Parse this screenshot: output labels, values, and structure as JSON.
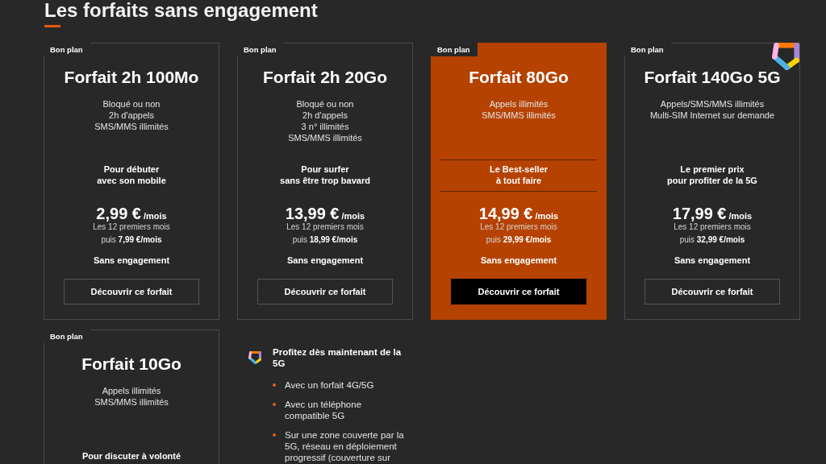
{
  "heading": {
    "title": "Les forfaits sans engagement"
  },
  "plans": [
    {
      "badge": "Bon plan",
      "name": "Forfait 2h 100Mo",
      "features": [
        "Bloqué ou non",
        "2h d'appels",
        "SMS/MMS illimités"
      ],
      "tagline": "Pour débuter\navec son mobile",
      "price": "2,99 €",
      "period": "/mois",
      "price_note": "Les 12 premiers mois",
      "later_price": "puis **7,99 €/mois**",
      "commitment": "Sans engagement",
      "button": "Découvrir ce forfait",
      "featured": false,
      "is_5g": false
    },
    {
      "badge": "Bon plan",
      "name": "Forfait 2h 20Go",
      "features": [
        "Bloqué ou non",
        "2h d'appels",
        "3 n° illimités",
        "SMS/MMS illimités"
      ],
      "tagline": "Pour surfer\nsans être trop bavard",
      "price": "13,99 €",
      "period": "/mois",
      "price_note": "Les 12 premiers mois",
      "later_price": "puis **18,99 €/mois**",
      "commitment": "Sans engagement",
      "button": "Découvrir ce forfait",
      "featured": false,
      "is_5g": false
    },
    {
      "badge": "Bon plan",
      "name": "Forfait 80Go",
      "features": [
        "Appels illimités",
        "SMS/MMS illimités"
      ],
      "tagline": "Le Best-seller\nà tout faire",
      "price": "14,99 €",
      "period": "/mois",
      "price_note": "Les 12 premiers mois",
      "later_price": "puis **29,99 €/mois**",
      "commitment": "Sans engagement",
      "button": "Découvrir ce forfait",
      "featured": true,
      "is_5g": false
    },
    {
      "badge": "Bon plan",
      "name": "Forfait 140Go 5G",
      "features": [
        "Appels/SMS/MMS illimités",
        "Multi-SIM Internet sur demande"
      ],
      "tagline": "Le premier prix\npour profiter de la 5G",
      "price": "17,99 €",
      "period": "/mois",
      "price_note": "Les 12 premiers mois",
      "later_price": "puis **32,99 €/mois**",
      "commitment": "Sans engagement",
      "button": "Découvrir ce forfait",
      "featured": false,
      "is_5g": true
    },
    {
      "badge": "Bon plan",
      "name": "Forfait 10Go",
      "features": [
        "Appels illimités",
        "SMS/MMS illimités"
      ],
      "tagline": "Pour discuter à volonté",
      "featured": false,
      "is_5g": false
    }
  ],
  "five_g_info": {
    "title": "Profitez dès maintenant de la 5G",
    "items": [
      "Avec un forfait 4G/5G",
      "Avec un téléphone compatible 5G",
      "Sur une zone couverte par la 5G, réseau en déploiement progressif (couverture sur"
    ]
  }
}
